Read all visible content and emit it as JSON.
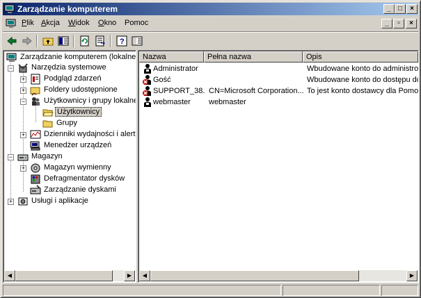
{
  "window": {
    "title": "Zarządzanie komputerem",
    "caption": {
      "minimize": "_",
      "maximize": "□",
      "close": "×"
    },
    "mdi": {
      "minimize": "_",
      "restore": "▫",
      "close": "×"
    }
  },
  "menu": [
    {
      "label": "Plik",
      "accel": "P",
      "rest": "lik"
    },
    {
      "label": "Akcja",
      "accel": "A",
      "rest": "kcja"
    },
    {
      "label": "Widok",
      "accel": "W",
      "rest": "idok"
    },
    {
      "label": "Okno",
      "accel": "O",
      "rest": "kno"
    },
    {
      "label": "Pomoc",
      "accel": "",
      "rest": "Pomoc"
    }
  ],
  "toolbar": {
    "buttons": [
      "back-icon",
      "forward-icon",
      "up-folder-icon",
      "show-tree-icon",
      "refresh-icon",
      "export-list-icon",
      "help-icon",
      "properties-icon"
    ]
  },
  "tree": {
    "root": "Zarządzanie komputerem (lokalne)",
    "system_tools": "Narzędzia systemowe",
    "event_viewer": "Podgląd zdarzeń",
    "shared_folders": "Foldery udostępnione",
    "local_users": "Użytkownicy i grupy lokalne",
    "users": "Użytkownicy",
    "groups": "Grupy",
    "perf_logs": "Dzienniki wydajności i alerty",
    "device_manager": "Menedżer urządzeń",
    "storage": "Magazyn",
    "removable_storage": "Magazyn wymienny",
    "defrag": "Defragmentator dysków",
    "disk_mgmt": "Zarządzanie dyskami",
    "services_apps": "Usługi i aplikacje"
  },
  "list": {
    "columns": [
      "Nazwa",
      "Pełna nazwa",
      "Opis"
    ],
    "rows": [
      {
        "name": "Administrator",
        "full": "",
        "desc": "Wbudowane konto do administrowa",
        "disabled": false
      },
      {
        "name": "Gość",
        "full": "",
        "desc": "Wbudowane konto do dostępu do k",
        "disabled": true
      },
      {
        "name": "SUPPORT_38...",
        "full": "CN=Microsoft Corporation...",
        "desc": "To jest konto dostawcy dla Pomocy",
        "disabled": true
      },
      {
        "name": "webmaster",
        "full": "webmaster",
        "desc": "",
        "disabled": false
      }
    ]
  },
  "colors": {
    "title_start": "#0a246a",
    "title_end": "#a6caf0",
    "disabled_badge": "#cc0000"
  }
}
